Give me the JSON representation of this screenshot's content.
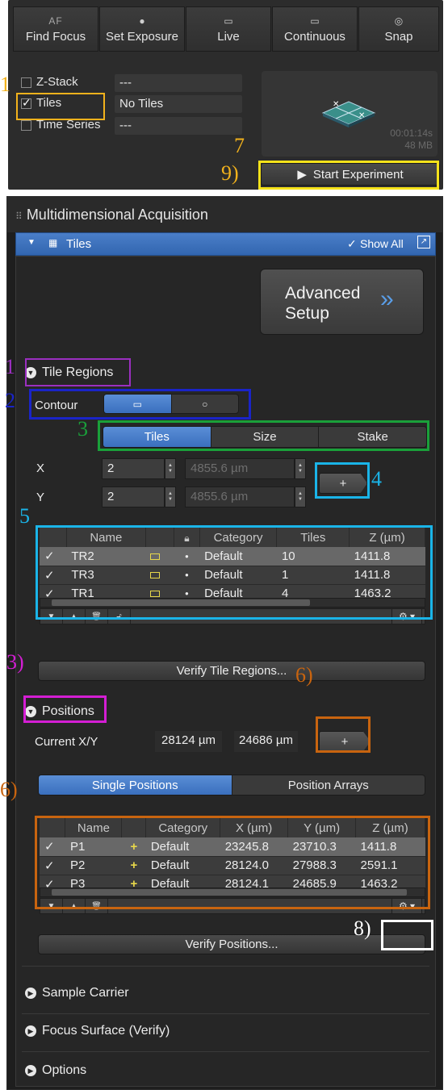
{
  "toolbar": {
    "find_focus": {
      "icon_text": "AF",
      "label": "Find Focus"
    },
    "set_exposure": {
      "label": "Set Exposure"
    },
    "live": {
      "label": "Live"
    },
    "continuous": {
      "label": "Continuous"
    },
    "snap": {
      "label": "Snap"
    }
  },
  "dimensions": [
    {
      "label": "Z-Stack",
      "value": "---",
      "checked": false
    },
    {
      "label": "Tiles",
      "value": "No Tiles",
      "checked": true
    },
    {
      "label": "Time Series",
      "value": "---",
      "checked": false
    }
  ],
  "preview": {
    "duration": "00:01:14s",
    "size": "48 MB"
  },
  "start_experiment": "Start Experiment",
  "panel_title": "Multidimensional Acquisition",
  "tiles_section": {
    "title": "Tiles",
    "show_all": "Show All"
  },
  "advanced_setup": {
    "line1": "Advanced",
    "line2": "Setup"
  },
  "tile_regions": {
    "title": "Tile Regions",
    "contour_label": "Contour",
    "mode_tabs": [
      "Tiles",
      "Size",
      "Stake"
    ],
    "x_label": "X",
    "y_label": "Y",
    "x_count": "2",
    "y_count": "2",
    "x_size": "4855.6 µm",
    "y_size": "4855.6 µm",
    "add_label": "+",
    "columns": [
      "Name",
      "",
      "",
      "Category",
      "Tiles",
      "Z (µm)"
    ],
    "rows": [
      {
        "name": "TR2",
        "category": "Default",
        "tiles": "10",
        "z": "1411.8"
      },
      {
        "name": "TR3",
        "category": "Default",
        "tiles": "1",
        "z": "1411.8"
      },
      {
        "name": "TR1",
        "category": "Default",
        "tiles": "4",
        "z": "1463.2"
      }
    ],
    "verify_label": "Verify Tile Regions..."
  },
  "positions": {
    "title": "Positions",
    "current_label": "Current X/Y",
    "current_x": "28124 µm",
    "current_y": "24686 µm",
    "add_label": "+",
    "tabs": [
      "Single Positions",
      "Position Arrays"
    ],
    "columns": [
      "Name",
      "",
      "Category",
      "X (µm)",
      "Y (µm)",
      "Z (µm)"
    ],
    "rows": [
      {
        "name": "P1",
        "category": "Default",
        "x": "23245.8",
        "y": "23710.3",
        "z": "1411.8"
      },
      {
        "name": "P2",
        "category": "Default",
        "x": "28124.0",
        "y": "27988.3",
        "z": "2591.1"
      },
      {
        "name": "P3",
        "category": "Default",
        "x": "28124.1",
        "y": "24685.9",
        "z": "1463.2"
      }
    ],
    "verify_label": "Verify Positions..."
  },
  "collapsed_sections": [
    "Sample Carrier",
    "Focus Surface (Verify)",
    "Options"
  ],
  "annotations": {
    "a1_top": "1",
    "a7": "7",
    "a9": "9)",
    "a1": "1",
    "a2": "2",
    "a3": "3",
    "a4": "4",
    "a5": "5",
    "a3b": "3)",
    "a6": "6)",
    "a6b": "6)",
    "a8": "8)"
  },
  "colors": {
    "annot_yellow": "#f2b21c",
    "annot_purple": "#9b2fc0",
    "annot_blue": "#1a24c8",
    "annot_green": "#1aa03a",
    "annot_cyan": "#1ab4e8",
    "annot_magenta": "#d41ed4",
    "annot_orange": "#c8640f",
    "annot_white": "#ffffff",
    "accent_blue": "#3a6fbe"
  }
}
